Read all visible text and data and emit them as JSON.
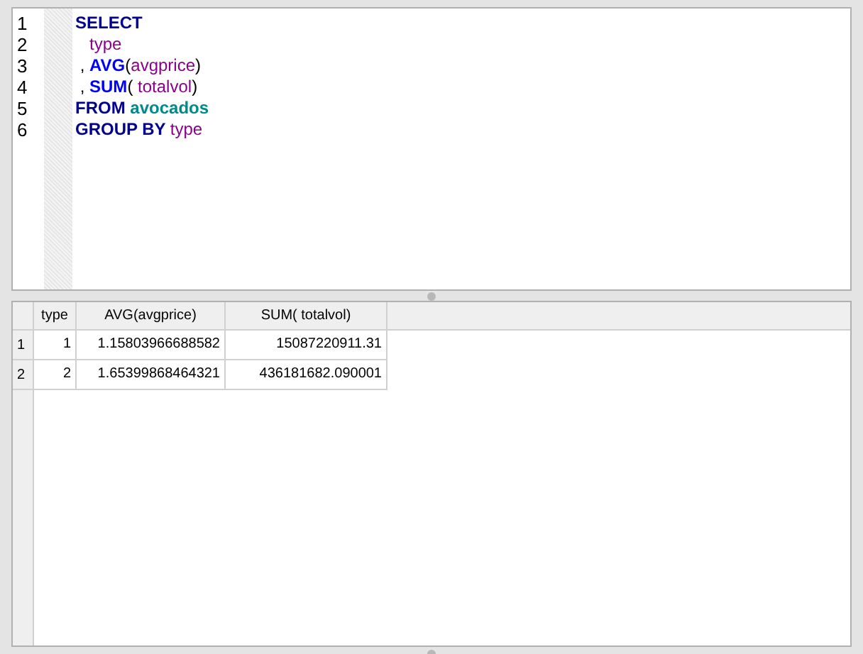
{
  "editor": {
    "lines": [
      {
        "number": "1",
        "tokens": [
          {
            "kind": "keyword",
            "text": "SELECT"
          }
        ]
      },
      {
        "number": "2",
        "indented": true,
        "tokens": [
          {
            "kind": "identifier",
            "text": "type"
          }
        ]
      },
      {
        "number": "3",
        "tokens": [
          {
            "kind": "plain",
            "text": " , "
          },
          {
            "kind": "function",
            "text": "AVG"
          },
          {
            "kind": "plain",
            "text": "("
          },
          {
            "kind": "identifier",
            "text": "avgprice"
          },
          {
            "kind": "plain",
            "text": ")"
          }
        ]
      },
      {
        "number": "4",
        "tokens": [
          {
            "kind": "plain",
            "text": " , "
          },
          {
            "kind": "function",
            "text": "SUM"
          },
          {
            "kind": "plain",
            "text": "( "
          },
          {
            "kind": "identifier",
            "text": "totalvol"
          },
          {
            "kind": "plain",
            "text": ")"
          }
        ]
      },
      {
        "number": "5",
        "tokens": [
          {
            "kind": "keyword",
            "text": "FROM "
          },
          {
            "kind": "table",
            "text": "avocados"
          }
        ]
      },
      {
        "number": "6",
        "tokens": [
          {
            "kind": "keyword",
            "text": "GROUP BY "
          },
          {
            "kind": "identifier",
            "text": "type"
          }
        ]
      }
    ]
  },
  "results": {
    "columns": [
      "type",
      "AVG(avgprice)",
      "SUM( totalvol)"
    ],
    "rows": [
      {
        "number": "1",
        "cells": [
          "1",
          "1.15803966688582",
          "15087220911.31"
        ]
      },
      {
        "number": "2",
        "cells": [
          "2",
          "1.65399868464321",
          "436181682.090001"
        ]
      }
    ]
  }
}
